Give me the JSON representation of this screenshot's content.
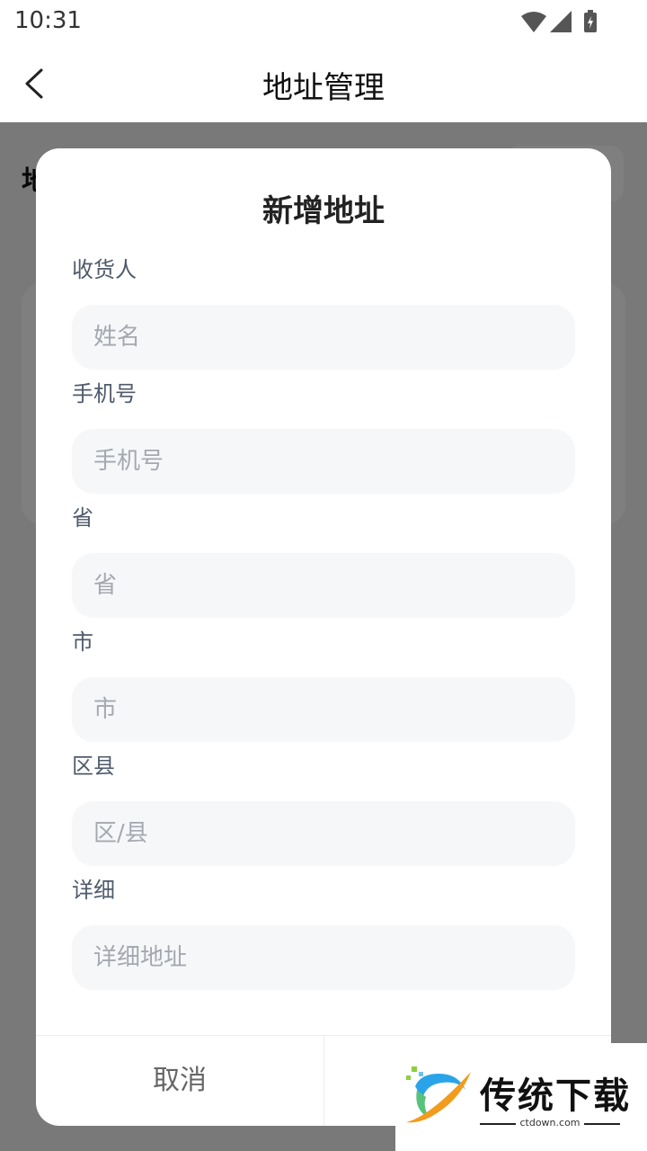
{
  "status_bar": {
    "time": "10:31",
    "icons": [
      "wifi-icon",
      "cellular-signal-icon",
      "battery-charging-icon"
    ]
  },
  "nav": {
    "title": "地址管理",
    "back_icon": "chevron-left-icon"
  },
  "background": {
    "heading_partial": "地"
  },
  "dialog": {
    "title": "新增地址",
    "fields": [
      {
        "label": "收货人",
        "placeholder": "姓名",
        "value": ""
      },
      {
        "label": "手机号",
        "placeholder": "手机号",
        "value": ""
      },
      {
        "label": "省",
        "placeholder": "省",
        "value": ""
      },
      {
        "label": "市",
        "placeholder": "市",
        "value": ""
      },
      {
        "label": "区县",
        "placeholder": "区/县",
        "value": ""
      },
      {
        "label": "详细",
        "placeholder": "详细地址",
        "value": ""
      }
    ],
    "cancel_label": "取消",
    "confirm_label": ""
  },
  "watermark": {
    "text": "传统下载",
    "domain": "ctdown.com"
  },
  "colors": {
    "overlay": "#808080",
    "input_bg": "#f6f7f9",
    "label": "#4f5a6b",
    "placeholder": "#a4a8b0"
  }
}
